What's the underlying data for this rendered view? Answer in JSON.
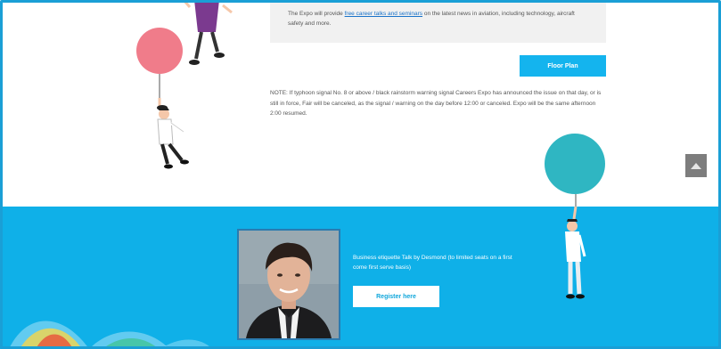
{
  "expo_info": {
    "text_before_link": "The Expo will provide ",
    "link_text": "free career talks and seminars",
    "text_after_link": " on the latest news in aviation, including technology, aircraft safety and more."
  },
  "floor_plan_button": {
    "label": "Floor Plan"
  },
  "note": {
    "text": "NOTE: If typhoon signal No. 8 or above / black rainstorm warning signal Careers Expo has announced the issue on that day, or is still in force, Fair will be canceled, as the signal / warning on the day before 12:00 or canceled. Expo will be the same afternoon 2:00 resumed."
  },
  "talk": {
    "text": "Business etiquette Talk by Desmond (to limited seats on a first come first serve basis)",
    "register_label": "Register here"
  },
  "colors": {
    "accent": "#14b4ee",
    "band": "#0fb0e8",
    "balloon_pink": "#f07c8a",
    "balloon_teal": "#2fb6c2",
    "back_to_top": "#7d7d7d"
  },
  "icons": {
    "back_to_top": "chevron-up-icon"
  }
}
